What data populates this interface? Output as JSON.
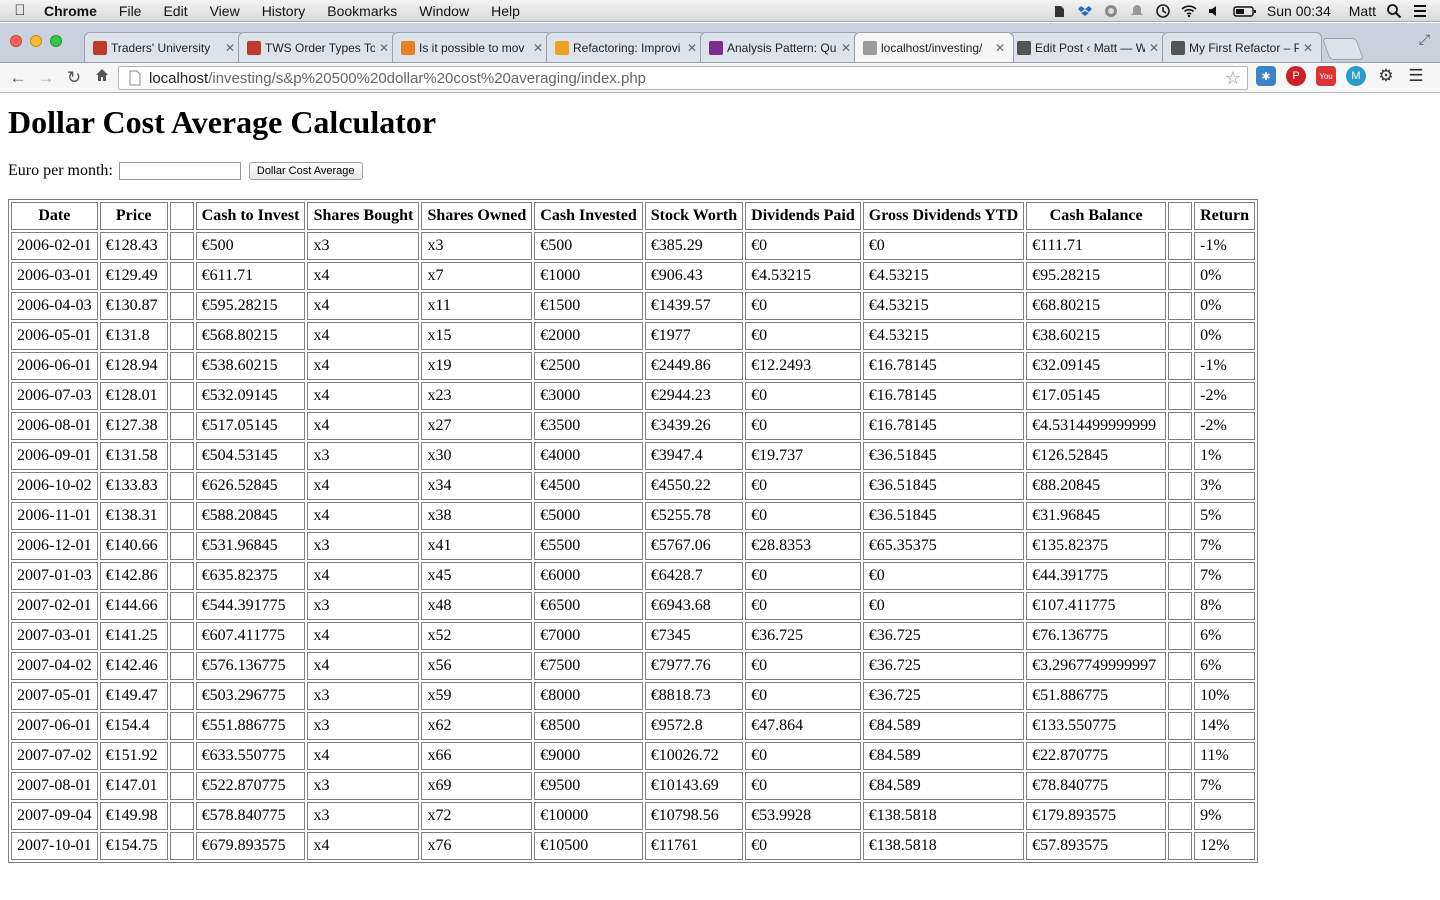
{
  "menubar": {
    "app": "Chrome",
    "menus": [
      "File",
      "Edit",
      "View",
      "History",
      "Bookmarks",
      "Window",
      "Help"
    ],
    "clock": "Sun 00:34",
    "user": "Matt"
  },
  "tabs": [
    {
      "label": "Traders' University",
      "fav_color": "#c0392b"
    },
    {
      "label": "TWS Order Types To",
      "fav_color": "#c0392b"
    },
    {
      "label": "Is it possible to mov",
      "fav_color": "#e87e23"
    },
    {
      "label": "Refactoring: Improvi",
      "fav_color": "#f0a020"
    },
    {
      "label": "Analysis Pattern: Qu",
      "fav_color": "#7b2e8e"
    },
    {
      "label": "localhost/investing/",
      "fav_color": "#9a9a9a"
    },
    {
      "label": "Edit Post ‹ Matt — W",
      "fav_color": "#555555"
    },
    {
      "label": "My First Refactor – P",
      "fav_color": "#555555"
    }
  ],
  "address": {
    "host": "localhost",
    "path": "/investing/s&p%20500%20dollar%20cost%20averaging/index.php"
  },
  "page": {
    "title": "Dollar Cost Average Calculator",
    "form_label": "Euro per month:",
    "input_value": "",
    "button_label": "Dollar Cost Average"
  },
  "table": {
    "headers": [
      "Date",
      "Price",
      "",
      "Cash to Invest",
      "Shares Bought",
      "Shares Owned",
      "Cash Invested",
      "Stock Worth",
      "Dividends Paid",
      "Gross Dividends YTD",
      "Cash Balance",
      "",
      "Return"
    ],
    "rows": [
      [
        "2006-02-01",
        "€128.43",
        "",
        "€500",
        "x3",
        "x3",
        "€500",
        "€385.29",
        "€0",
        "€0",
        "€111.71",
        "",
        "-1%"
      ],
      [
        "2006-03-01",
        "€129.49",
        "",
        "€611.71",
        "x4",
        "x7",
        "€1000",
        "€906.43",
        "€4.53215",
        "€4.53215",
        "€95.28215",
        "",
        "0%"
      ],
      [
        "2006-04-03",
        "€130.87",
        "",
        "€595.28215",
        "x4",
        "x11",
        "€1500",
        "€1439.57",
        "€0",
        "€4.53215",
        "€68.80215",
        "",
        "0%"
      ],
      [
        "2006-05-01",
        "€131.8",
        "",
        "€568.80215",
        "x4",
        "x15",
        "€2000",
        "€1977",
        "€0",
        "€4.53215",
        "€38.60215",
        "",
        "0%"
      ],
      [
        "2006-06-01",
        "€128.94",
        "",
        "€538.60215",
        "x4",
        "x19",
        "€2500",
        "€2449.86",
        "€12.2493",
        "€16.78145",
        "€32.09145",
        "",
        "-1%"
      ],
      [
        "2006-07-03",
        "€128.01",
        "",
        "€532.09145",
        "x4",
        "x23",
        "€3000",
        "€2944.23",
        "€0",
        "€16.78145",
        "€17.05145",
        "",
        "-2%"
      ],
      [
        "2006-08-01",
        "€127.38",
        "",
        "€517.05145",
        "x4",
        "x27",
        "€3500",
        "€3439.26",
        "€0",
        "€16.78145",
        "€4.5314499999999",
        "",
        "-2%"
      ],
      [
        "2006-09-01",
        "€131.58",
        "",
        "€504.53145",
        "x3",
        "x30",
        "€4000",
        "€3947.4",
        "€19.737",
        "€36.51845",
        "€126.52845",
        "",
        "1%"
      ],
      [
        "2006-10-02",
        "€133.83",
        "",
        "€626.52845",
        "x4",
        "x34",
        "€4500",
        "€4550.22",
        "€0",
        "€36.51845",
        "€88.20845",
        "",
        "3%"
      ],
      [
        "2006-11-01",
        "€138.31",
        "",
        "€588.20845",
        "x4",
        "x38",
        "€5000",
        "€5255.78",
        "€0",
        "€36.51845",
        "€31.96845",
        "",
        "5%"
      ],
      [
        "2006-12-01",
        "€140.66",
        "",
        "€531.96845",
        "x3",
        "x41",
        "€5500",
        "€5767.06",
        "€28.8353",
        "€65.35375",
        "€135.82375",
        "",
        "7%"
      ],
      [
        "2007-01-03",
        "€142.86",
        "",
        "€635.82375",
        "x4",
        "x45",
        "€6000",
        "€6428.7",
        "€0",
        "€0",
        "€44.391775",
        "",
        "7%"
      ],
      [
        "2007-02-01",
        "€144.66",
        "",
        "€544.391775",
        "x3",
        "x48",
        "€6500",
        "€6943.68",
        "€0",
        "€0",
        "€107.411775",
        "",
        "8%"
      ],
      [
        "2007-03-01",
        "€141.25",
        "",
        "€607.411775",
        "x4",
        "x52",
        "€7000",
        "€7345",
        "€36.725",
        "€36.725",
        "€76.136775",
        "",
        "6%"
      ],
      [
        "2007-04-02",
        "€142.46",
        "",
        "€576.136775",
        "x4",
        "x56",
        "€7500",
        "€7977.76",
        "€0",
        "€36.725",
        "€3.2967749999997",
        "",
        "6%"
      ],
      [
        "2007-05-01",
        "€149.47",
        "",
        "€503.296775",
        "x3",
        "x59",
        "€8000",
        "€8818.73",
        "€0",
        "€36.725",
        "€51.886775",
        "",
        "10%"
      ],
      [
        "2007-06-01",
        "€154.4",
        "",
        "€551.886775",
        "x3",
        "x62",
        "€8500",
        "€9572.8",
        "€47.864",
        "€84.589",
        "€133.550775",
        "",
        "14%"
      ],
      [
        "2007-07-02",
        "€151.92",
        "",
        "€633.550775",
        "x4",
        "x66",
        "€9000",
        "€10026.72",
        "€0",
        "€84.589",
        "€22.870775",
        "",
        "11%"
      ],
      [
        "2007-08-01",
        "€147.01",
        "",
        "€522.870775",
        "x3",
        "x69",
        "€9500",
        "€10143.69",
        "€0",
        "€84.589",
        "€78.840775",
        "",
        "7%"
      ],
      [
        "2007-09-04",
        "€149.98",
        "",
        "€578.840775",
        "x3",
        "x72",
        "€10000",
        "€10798.56",
        "€53.9928",
        "€138.5818",
        "€179.893575",
        "",
        "9%"
      ],
      [
        "2007-10-01",
        "€154.75",
        "",
        "€679.893575",
        "x4",
        "x76",
        "€10500",
        "€11761",
        "€0",
        "€138.5818",
        "€57.893575",
        "",
        "12%"
      ]
    ]
  }
}
